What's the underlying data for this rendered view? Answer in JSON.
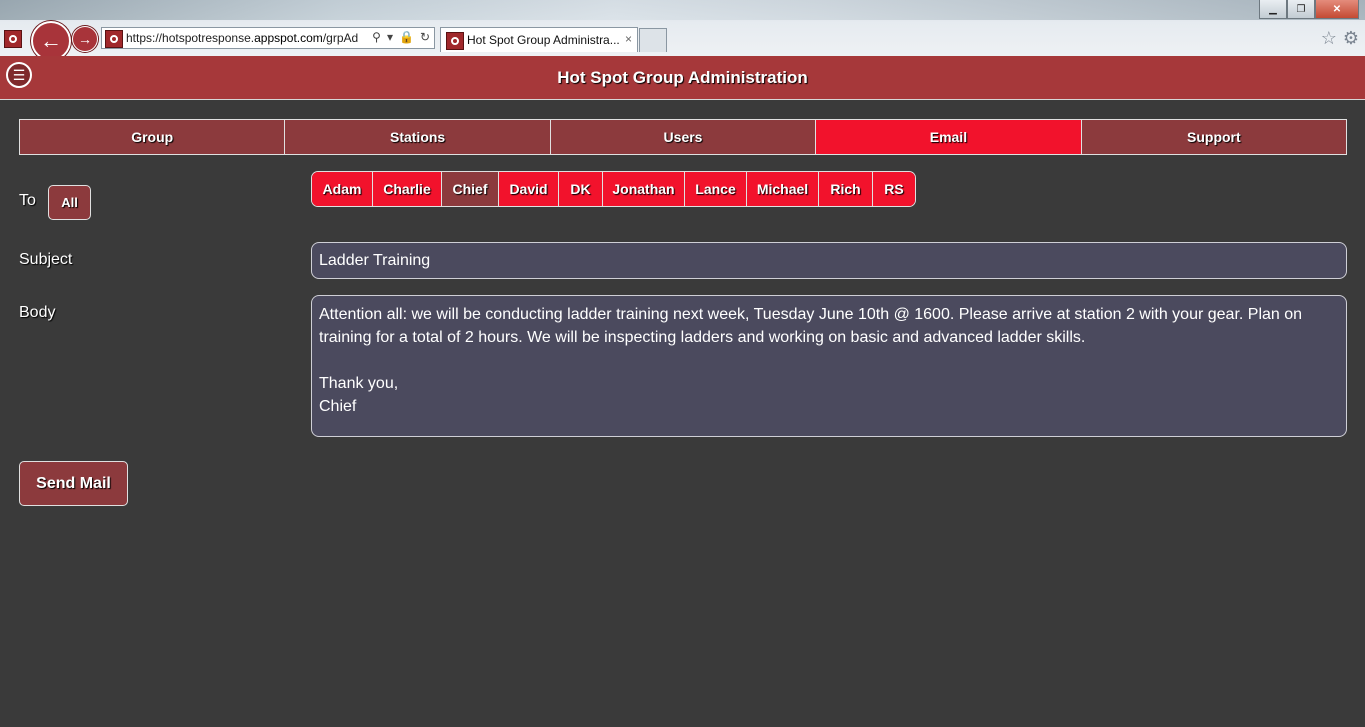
{
  "browser": {
    "url_prefix": "https://hotspotresponse.",
    "url_domain": "appspot.com",
    "url_suffix": "/grpAd",
    "tab_title": "Hot Spot Group Administra...",
    "tab_close": "×"
  },
  "header": {
    "title": "Hot Spot Group Administration",
    "menu_icon": "☰"
  },
  "tabs": [
    {
      "label": "Group"
    },
    {
      "label": "Stations"
    },
    {
      "label": "Users"
    },
    {
      "label": "Email",
      "active": true
    },
    {
      "label": "Support"
    }
  ],
  "form": {
    "to_label": "To",
    "all_button": "All",
    "recipients": [
      "Adam",
      "Charlie",
      "Chief",
      "David",
      "DK",
      "Jonathan",
      "Lance",
      "Michael",
      "Rich",
      "RS"
    ],
    "selected_recipient": "Chief",
    "subject_label": "Subject",
    "subject_value": "Ladder Training",
    "body_label": "Body",
    "body_value": "Attention all: we will be conducting ladder training next week, Tuesday June 10th @ 1600. Please arrive at station 2 with your gear. Plan on training for a total of 2 hours. We will be inspecting ladders and working on basic and advanced ladder skills.\n\nThank you,\nChief",
    "send_button": "Send Mail"
  },
  "colors": {
    "header": "#a6383a",
    "tab": "#8c3a3d",
    "tab_active": "#f2122c",
    "field_bg": "#4b4a5e",
    "page_bg": "#3a3a3a"
  }
}
